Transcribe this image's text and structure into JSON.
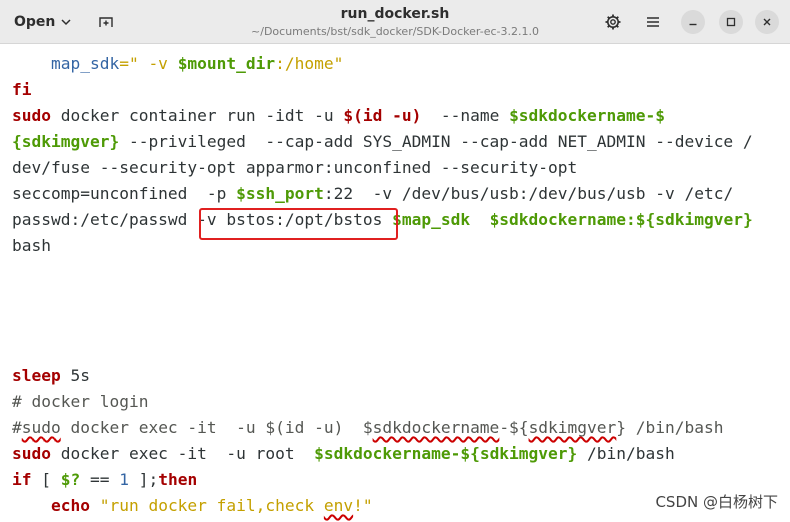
{
  "header": {
    "open_label": "Open",
    "title": "run_docker.sh",
    "subtitle": "~/Documents/bst/sdk_docker/SDK-Docker-ec-3.2.1.0",
    "icons": [
      "chevron-down-icon",
      "new-tab-icon",
      "gear-icon",
      "hamburger-menu-icon",
      "minimize-icon",
      "maximize-icon",
      "close-icon"
    ]
  },
  "editor": {
    "lines": [
      [
        {
          "t": "    map_sdk",
          "c": "nm"
        },
        {
          "t": "=\" -v ",
          "c": "st"
        },
        {
          "t": "$mount_dir",
          "c": "vr"
        },
        {
          "t": ":/home\"",
          "c": "st"
        }
      ],
      [
        {
          "t": "fi",
          "c": "kw"
        }
      ],
      [
        {
          "t": "sudo",
          "c": "kw"
        },
        {
          "t": " docker container run -idt -u "
        },
        {
          "t": "$(",
          "c": "kw"
        },
        {
          "t": "id -u",
          "c": "kw"
        },
        {
          "t": ")",
          "c": "kw"
        },
        {
          "t": "  --name "
        },
        {
          "t": "$sdkdockername",
          "c": "vr"
        },
        {
          "t": "-",
          "c": "vr"
        },
        {
          "t": "$",
          "c": "vr"
        }
      ],
      [
        {
          "t": "{sdkimgver}",
          "c": "vr"
        },
        {
          "t": " --privileged  --cap-add SYS_ADMIN --cap-add NET_ADMIN --device /"
        }
      ],
      [
        {
          "t": "dev/fuse --security-opt apparmor:unconfined --security-opt"
        }
      ],
      [
        {
          "t": "seccomp=unconfined  -p "
        },
        {
          "t": "$ssh_port",
          "c": "vr"
        },
        {
          "t": ":22  -v /dev/bus/usb:/dev/bus/usb -v /etc/"
        }
      ],
      [
        {
          "t": "passwd:/etc/passwd "
        },
        {
          "t": "-v bstos:/opt/bstos "
        },
        {
          "t": "$map_sdk",
          "c": "vr"
        },
        {
          "t": "  "
        },
        {
          "t": "$sdkdockername",
          "c": "vr"
        },
        {
          "t": ":",
          "c": "vr"
        },
        {
          "t": "${sdkimgver}",
          "c": "vr"
        }
      ],
      [
        {
          "t": "bash"
        }
      ],
      [],
      [],
      [],
      [],
      [
        {
          "t": "sleep",
          "c": "kw"
        },
        {
          "t": " 5s"
        }
      ],
      [
        {
          "t": "# docker login",
          "c": "cm"
        }
      ],
      [
        {
          "t": "#",
          "c": "cm"
        },
        {
          "t": "sudo",
          "c": "cm sq"
        },
        {
          "t": " docker exec -it  -u $(id -u)  $",
          "c": "cm"
        },
        {
          "t": "sdkdockername",
          "c": "cm sq"
        },
        {
          "t": "-${",
          "c": "cm"
        },
        {
          "t": "sdkimgver",
          "c": "cm sq"
        },
        {
          "t": "} /bin/bash",
          "c": "cm"
        }
      ],
      [
        {
          "t": "sudo",
          "c": "kw"
        },
        {
          "t": " docker exec -it  -u root  "
        },
        {
          "t": "$sdkdockername",
          "c": "vr"
        },
        {
          "t": "-",
          "c": "vr"
        },
        {
          "t": "${sdkimgver}",
          "c": "vr"
        },
        {
          "t": " /bin/bash"
        }
      ],
      [
        {
          "t": "if",
          "c": "kw"
        },
        {
          "t": " [ "
        },
        {
          "t": "$?",
          "c": "vr"
        },
        {
          "t": " == "
        },
        {
          "t": "1",
          "c": "nm"
        },
        {
          "t": " ];"
        },
        {
          "t": "then",
          "c": "kw"
        }
      ],
      [
        {
          "t": "    "
        },
        {
          "t": "echo",
          "c": "kw"
        },
        {
          "t": " "
        },
        {
          "t": "\"run docker fail,check ",
          "c": "st"
        },
        {
          "t": "env",
          "c": "st sq"
        },
        {
          "t": "!\"",
          "c": "st"
        }
      ]
    ]
  },
  "watermark": "CSDN @白杨树下",
  "colors": {
    "keyword": "#a40000",
    "variable": "#4e9a06",
    "string": "#c4a000",
    "comment": "#555753",
    "highlight_border": "#e02020"
  }
}
